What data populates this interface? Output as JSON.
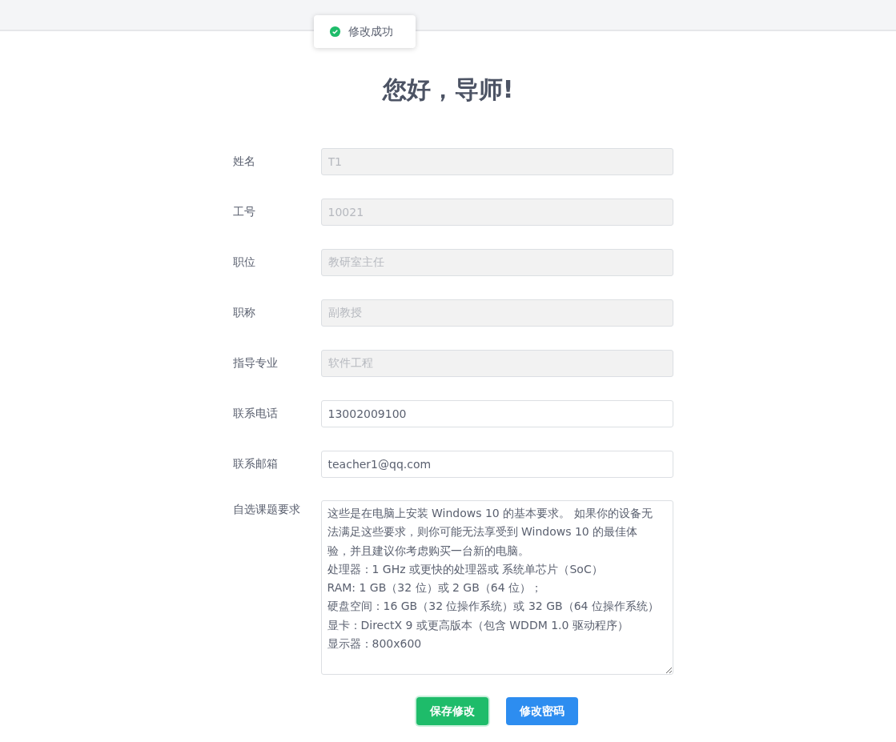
{
  "toast": {
    "kind": "success",
    "message": "修改成功"
  },
  "title": "您好，导师!",
  "fields": [
    {
      "label": "姓名",
      "kind": "input",
      "value": "T1",
      "disabled": true
    },
    {
      "label": "工号",
      "kind": "input",
      "value": "10021",
      "disabled": true
    },
    {
      "label": "职位",
      "kind": "input",
      "value": "教研室主任",
      "disabled": true
    },
    {
      "label": "职称",
      "kind": "input",
      "value": "副教授",
      "disabled": true
    },
    {
      "label": "指导专业",
      "kind": "input",
      "value": "软件工程",
      "disabled": true
    },
    {
      "label": "联系电话",
      "kind": "input",
      "value": "13002009100",
      "disabled": false
    },
    {
      "label": "联系邮箱",
      "kind": "input",
      "value": "teacher1@qq.com",
      "disabled": false
    },
    {
      "label": "自选课题要求",
      "kind": "textarea",
      "lines": [
        "这些是在电脑上安装 Windows 10 的基本要求。 如果你的设备无法满足这些要求，则你可能无法享受到 Windows 10 的最佳体验，并且建议你考虑购买一台新的电脑。",
        "处理器：1 GHz 或更快的处理器或 系统单芯片（SoC）",
        "RAM: 1 GB（32 位）或 2 GB（64 位）；",
        "硬盘空间：16 GB（32 位操作系统）或 32 GB（64 位操作系统）",
        "显卡：DirectX 9 或更高版本（包含 WDDM 1.0 驱动程序）",
        "显示器：800x600"
      ],
      "disabled": false
    }
  ],
  "buttons": [
    {
      "label": "保存修改",
      "kind": "success"
    },
    {
      "label": "修改密码",
      "kind": "primary"
    }
  ]
}
